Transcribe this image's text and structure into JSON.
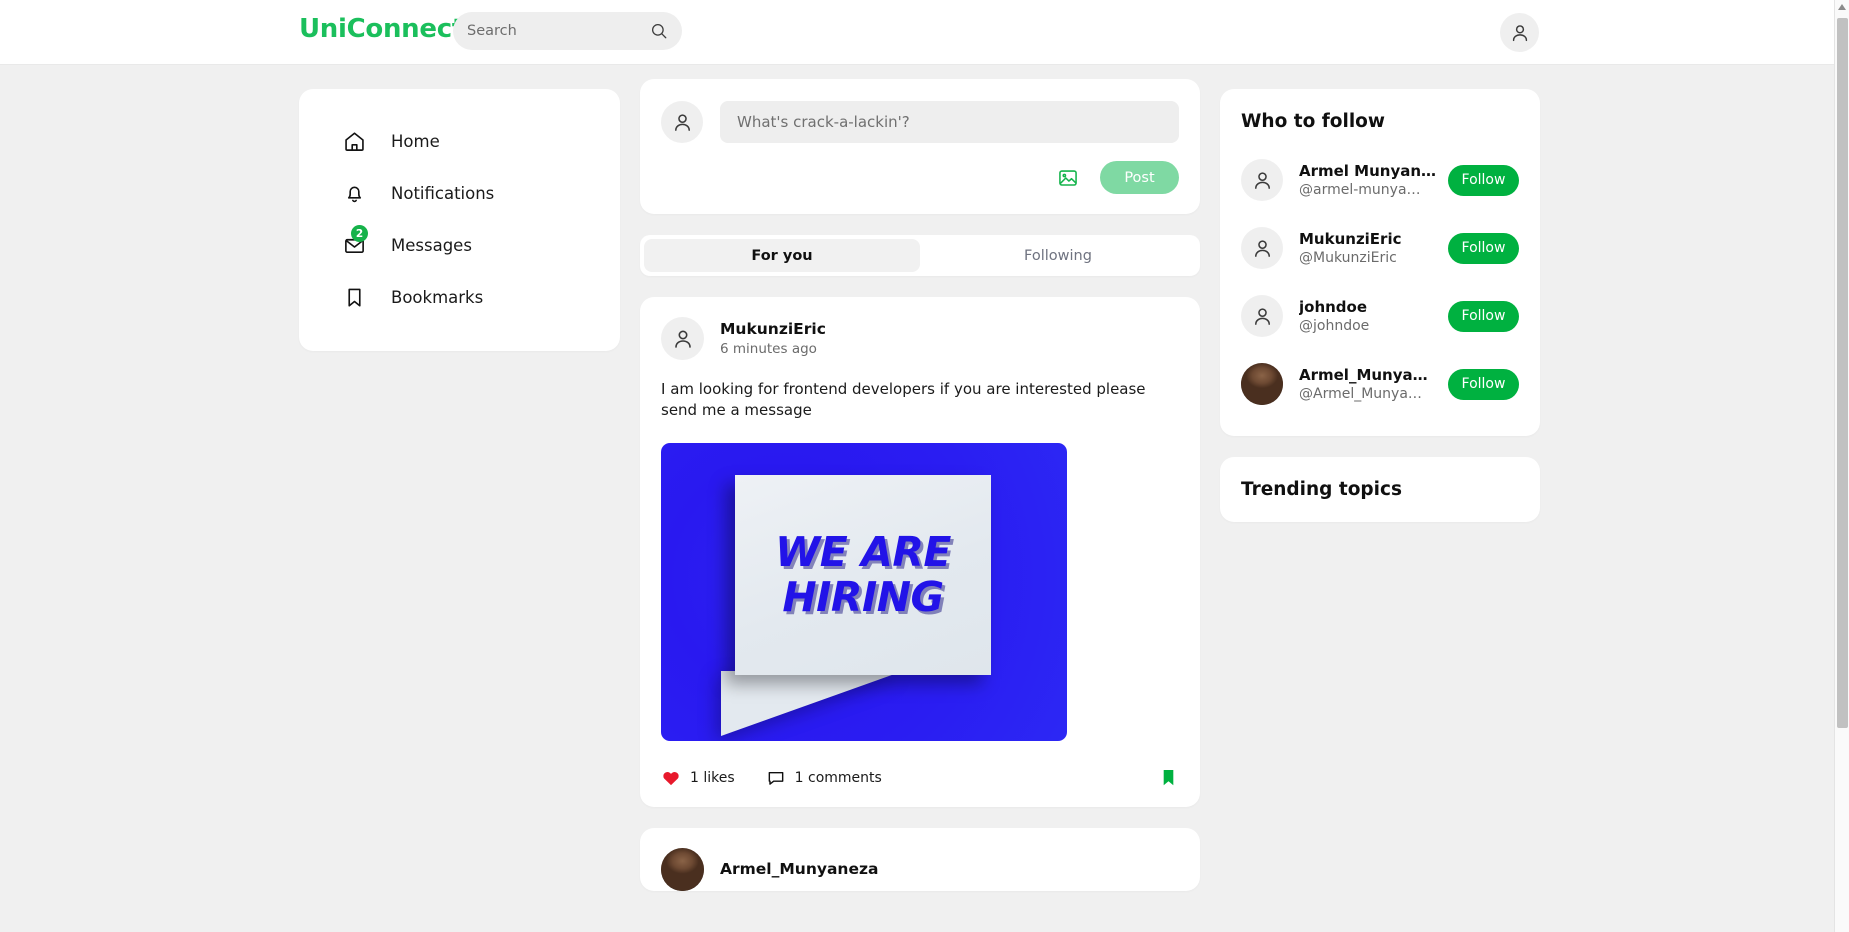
{
  "header": {
    "brand": "UniConnect",
    "search_placeholder": "Search",
    "search_value": "",
    "search_icon": "search-icon",
    "avatar_icon": "user-avatar-icon"
  },
  "sidebar": {
    "items": [
      {
        "label": "Home",
        "icon": "home-icon",
        "badge": ""
      },
      {
        "label": "Notifications",
        "icon": "bell-icon",
        "badge": ""
      },
      {
        "label": "Messages",
        "icon": "envelope-icon",
        "badge": "2"
      },
      {
        "label": "Bookmarks",
        "icon": "bookmark-icon",
        "badge": ""
      }
    ]
  },
  "composer": {
    "placeholder": "What's crack-a-lackin'?",
    "value": "",
    "image_icon": "image-icon",
    "post_label": "Post",
    "avatar_icon": "user-avatar-icon"
  },
  "tabs": [
    {
      "label": "For you",
      "active": true
    },
    {
      "label": "Following",
      "active": false
    }
  ],
  "posts": [
    {
      "author": "MukunziEric",
      "time": "6 minutes ago",
      "text": "I am looking for frontend developers if you are interested please send me a message",
      "avatar_type": "placeholder",
      "image": {
        "line1": "WE ARE",
        "line2": "HIRING",
        "background_color": "#2919f0",
        "bubble_color": "#e6ecf2",
        "text_color": "#2213e8"
      },
      "likes_label": "1 likes",
      "comments_label": "1 comments",
      "like_icon": "heart-icon",
      "comment_icon": "comment-icon",
      "bookmark_icon": "bookmark-icon",
      "liked": true,
      "bookmarked": true
    },
    {
      "author": "Armel_Munyaneza",
      "time": "",
      "text": "",
      "avatar_type": "photo"
    }
  ],
  "rail": {
    "who_to_follow_title": "Who to follow",
    "follow_button_label": "Follow",
    "suggestions": [
      {
        "name": "Armel Munyaneza",
        "handle": "@armel-munya…",
        "avatar_type": "placeholder"
      },
      {
        "name": "MukunziEric",
        "handle": "@MukunziEric",
        "avatar_type": "placeholder"
      },
      {
        "name": "johndoe",
        "handle": "@johndoe",
        "avatar_type": "placeholder"
      },
      {
        "name": "Armel_Munyan…",
        "handle": "@Armel_Munya…",
        "avatar_type": "photo"
      }
    ],
    "trending_title": "Trending topics"
  },
  "colors": {
    "brand_green": "#1bbf5c",
    "follow_green": "#00b140",
    "post_green_muted": "#7fd9a3",
    "badge_green": "#16b24a",
    "like_red": "#e8192c",
    "bookmark_green": "#00b140",
    "page_bg": "#f0f0f0"
  }
}
